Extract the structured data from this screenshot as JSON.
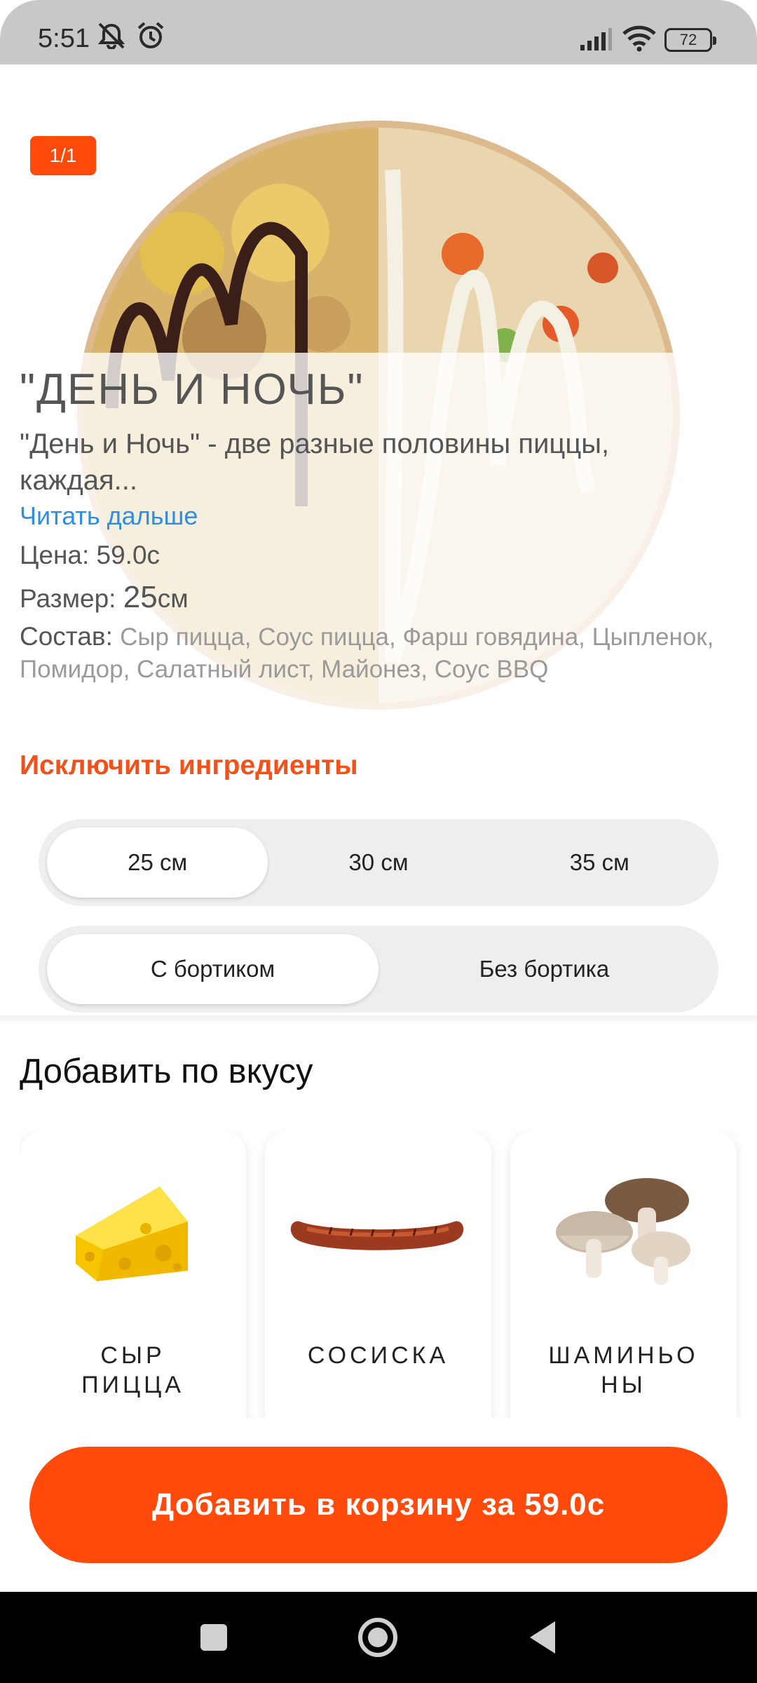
{
  "status_bar": {
    "time": "5:51",
    "battery": "72"
  },
  "gallery": {
    "counter": "1/1"
  },
  "product": {
    "title": "\"ДЕНЬ И НОЧЬ\"",
    "description": "\"День и Ночь\" - две разные половины пиццы, каждая...",
    "read_more": "Читать дальше",
    "price_label": "Цена: ",
    "price_value": "59.0",
    "price_unit": "с",
    "size_label": "Размер: ",
    "size_value": "25",
    "size_unit": "см",
    "composition_label": "Состав: ",
    "composition_value": "Сыр пицца, Соус пицца, Фарш говядина, Цыпленок, Помидор, Салатный лист, Майонез, Соус BBQ"
  },
  "exclude_ingredients": "Исключить ингредиенты",
  "size_options": [
    {
      "label": "25 см",
      "selected": true
    },
    {
      "label": "30 см",
      "selected": false
    },
    {
      "label": "35 см",
      "selected": false
    }
  ],
  "crust_options": [
    {
      "label": "С бортиком",
      "selected": true
    },
    {
      "label": "Без бортика",
      "selected": false
    }
  ],
  "addons": {
    "title": "Добавить по вкусу",
    "items": [
      {
        "name": "СЫР\nПИЦЦА",
        "icon": "cheese-icon"
      },
      {
        "name": "СОСИСКА",
        "icon": "sausage-icon"
      },
      {
        "name": "ШАМИНЬО\nНЫ",
        "icon": "mushroom-icon"
      }
    ]
  },
  "cart_button": "Добавить в корзину за 59.0с",
  "colors": {
    "accent": "#ff4a0b",
    "link": "#2f8de4",
    "exclude": "#f2521a"
  }
}
